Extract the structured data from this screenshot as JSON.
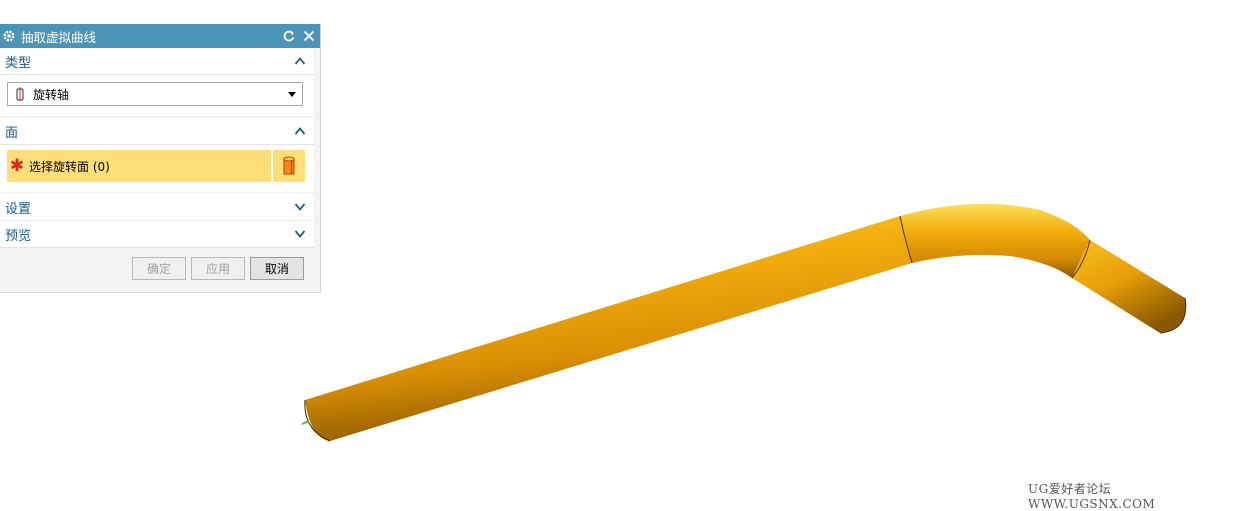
{
  "dialog": {
    "title": "抽取虚拟曲线",
    "sections": {
      "type": {
        "label": "类型",
        "expanded": true
      },
      "face": {
        "label": "面",
        "expanded": true
      },
      "settings": {
        "label": "设置",
        "expanded": false
      },
      "preview": {
        "label": "预览",
        "expanded": false
      }
    },
    "type_select": {
      "value": "旋转轴",
      "icon": "revolve-axis-icon"
    },
    "face_selection": {
      "label": "选择旋转面 (0)",
      "required_icon": "asterisk",
      "button_icon": "cylinder-face-icon"
    },
    "buttons": {
      "ok": "确定",
      "apply": "应用",
      "cancel": "取消"
    }
  },
  "viewport": {
    "model": "bent-pipe",
    "model_color": "#f2aa0a"
  },
  "watermark": "UG爱好者论坛 WWW.UGSNX.COM"
}
